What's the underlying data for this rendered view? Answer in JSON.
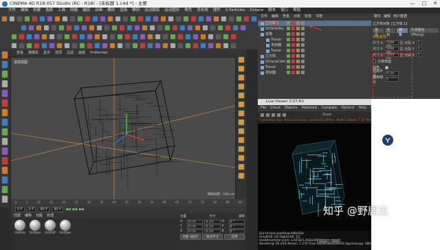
{
  "titlebar": {
    "title": "CINEMA 4D R18.057 Studio (RC - R18) - [未标题 1.c4d *] - 主要"
  },
  "window_controls": {
    "minimize": "—",
    "maximize": "□",
    "close": "✕"
  },
  "menubar": [
    "文件",
    "编辑",
    "创建",
    "选择",
    "工具",
    "网格",
    "捕捉",
    "动画",
    "模拟",
    "渲染",
    "雕刻",
    "运动跟踪",
    "运动图形",
    "角色",
    "流水线",
    "插件",
    "X-Particles",
    "Octane",
    "脚本",
    "窗口",
    "帮助"
  ],
  "viewport": {
    "menu": [
      "查看",
      "摄像机",
      "显示",
      "选项",
      "过滤",
      "面板",
      "ProRender"
    ],
    "label": "透视视图",
    "grid_text": "网格间距 : 100 cm"
  },
  "timeline": {
    "ticks": [
      "0",
      "5",
      "10",
      "15",
      "20",
      "25",
      "30",
      "35",
      "40",
      "45",
      "50",
      "55",
      "60",
      "65",
      "70",
      "75",
      "80",
      "85",
      "90"
    ],
    "frame_end": "0 F"
  },
  "transport": {
    "start": "0 F",
    "current": "0 F",
    "end": "90 F",
    "end2": "90 F"
  },
  "materials": {
    "menu": [
      "创建",
      "编辑",
      "功能",
      "纹理"
    ],
    "items": [
      "OctGlo",
      "OctSpe",
      "OctDiff",
      "OctSpe"
    ]
  },
  "coords": {
    "headers": [
      "位置",
      "尺寸",
      "旋转"
    ],
    "rows": [
      {
        "axis": "X",
        "pos": "0 cm",
        "size": "0 cm",
        "rot_label": "H",
        "rot": "0 °"
      },
      {
        "axis": "Y",
        "pos": "0 cm",
        "size": "0 cm",
        "rot_label": "P",
        "rot": "0 °"
      },
      {
        "axis": "Z",
        "pos": "0 cm",
        "size": "0 cm",
        "rot_label": "B",
        "rot": "0 °"
      }
    ],
    "mode": "对象 (相对)",
    "size_mode": "绝对尺寸",
    "apply": "应用"
  },
  "object_manager": {
    "tabs": [
      "文件",
      "编辑",
      "查看",
      "对象",
      "标签",
      "书签"
    ],
    "rows": [
      {
        "name": "立方体.1",
        "indent": 0,
        "selected": true
      },
      {
        "name": "OctaneSky",
        "indent": 0,
        "selected": false
      },
      {
        "name": "克隆",
        "indent": 0,
        "selected": false
      },
      {
        "name": "Tracer",
        "indent": 1,
        "selected": false
      },
      {
        "name": "发射器",
        "indent": 1,
        "selected": false
      },
      {
        "name": "Tracer",
        "indent": 1,
        "selected": false
      },
      {
        "name": "立方体",
        "indent": 0,
        "selected": false
      },
      {
        "name": "OctaneCam",
        "indent": 0,
        "selected": false
      },
      {
        "name": "Tracer",
        "indent": 0,
        "selected": false
      },
      {
        "name": "发射器",
        "indent": 0,
        "selected": false
      }
    ]
  },
  "attributes": {
    "tabs": [
      "模式",
      "编辑",
      "用户数据"
    ],
    "header": "立方体对象 [立方体.1]",
    "subtabs": [
      "基本",
      "坐标",
      "对象",
      "平滑着色(Phong)"
    ],
    "section": "对象属性",
    "size_rows": [
      {
        "label": "尺寸.X",
        "value": "5000 cm",
        "seg_label": "分段 X",
        "seg": "1"
      },
      {
        "label": "尺寸.Y",
        "value": "5000 cm",
        "seg_label": "分段 Y",
        "seg": "1"
      },
      {
        "label": "尺寸.Z",
        "value": "5000 cm",
        "seg_label": "分段 Z",
        "seg": "1"
      }
    ],
    "separate": "分离表面",
    "fillet_label": "圆角",
    "fillet_radius_label": "圆角半径",
    "fillet_radius": "0 cm",
    "fillet_sub_label": "圆角细分",
    "fillet_sub": "5"
  },
  "live_viewer": {
    "title": "Live Viewer 3.07-R2",
    "menu": [
      "File",
      "Cloud",
      "Objects",
      "Materials",
      "Compare",
      "Options",
      "Help",
      "Gui"
    ],
    "status": "Check:Kes: Ena: Mesh:Gen:Data: Update(5):360ms: Mesh:1 Nodes:7 VF Mimmets:94 Time:0 Tube/s",
    "info_lines": [
      "Out-of-core used/max:0Kb/4Gb",
      "Grey8/16: 0/0          Rgb32/64: 1/1",
      "Used/free/total vram: 1.02Gb/1.44Gb/4Gb",
      "Rendering: 95.45%  Ms/sec: 1.279  Time: 00:00:03/00:00:04  Spp/maxspp: 484/500"
    ],
    "zoom": "Zoom",
    "rnd": "Rnd"
  },
  "watermark": "知乎 @野鹿志",
  "colors": {
    "selection": "#5a6f8c",
    "highlight": "#ee3333",
    "accent_orange": "#d07a2a",
    "cyan_glow": "#7fe8ff"
  }
}
